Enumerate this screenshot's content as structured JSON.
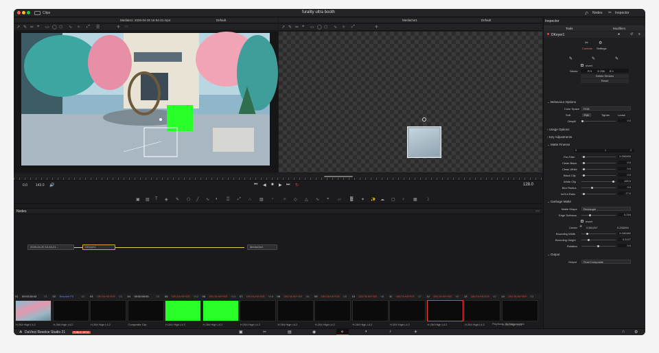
{
  "app": {
    "title": "furality ultra booth",
    "clips_label": "Clips",
    "product": "DaVinci Resolve Studio 21",
    "badge": "PUBLIC BETA"
  },
  "header": {
    "nodes_label": "Nodes",
    "inspector_label": "Inspector"
  },
  "viewer_left": {
    "title": "MediaIn1: 2026-04-20 16-54-21.mp4",
    "preset": "Default"
  },
  "viewer_right": {
    "title": "MediaOut1",
    "preset": "Default"
  },
  "transport": {
    "start": "0.0",
    "end": "143.0",
    "current": "128.0"
  },
  "nodes_panel": {
    "title": "Nodes",
    "nodes": [
      {
        "name": "2026-04-20 16-54-21..."
      },
      {
        "name": "DKeyer1"
      },
      {
        "name": "MediaOut1"
      }
    ]
  },
  "clips": [
    {
      "num": "01",
      "tc": "00:03:28:43",
      "v": "V1",
      "codec": "H.264 High L4.2"
    },
    {
      "num": "02",
      "tc": "Resolve FX",
      "v": "V2",
      "codec": "H.264 High L4.2"
    },
    {
      "num": "03",
      "tc": "DELTA KEYER",
      "v": "V3",
      "codec": "H.264 High L4.2"
    },
    {
      "num": "04",
      "tc": "00:00:00:00",
      "v": "V3",
      "codec": "Composite Clip"
    },
    {
      "num": "05",
      "tc": "DELTA KEYER",
      "v": "V12",
      "codec": "H.264 High L4.2"
    },
    {
      "num": "06",
      "tc": "DELTA KEYER",
      "v": "V14",
      "codec": "H.264 High L4.2"
    },
    {
      "num": "07",
      "tc": "DELTA KEYER",
      "v": "V15",
      "codec": "H.264 High L4.2"
    },
    {
      "num": "08",
      "tc": "DELTA KEYER",
      "v": "V6",
      "codec": "H.264 High L4.2"
    },
    {
      "num": "09",
      "tc": "DELTA KEYER",
      "v": "V8",
      "codec": "H.264 High L4.2"
    },
    {
      "num": "10",
      "tc": "DELTA KEYER",
      "v": "V8",
      "codec": "H.264 High L4.2"
    },
    {
      "num": "11",
      "tc": "DELTA KEYER",
      "v": "V7",
      "codec": "H.264 High L4.2"
    },
    {
      "num": "12",
      "tc": "DELTA KEYER",
      "v": "V2",
      "codec": "H.264 High L4.2"
    },
    {
      "num": "13",
      "tc": "DELTA KEYER",
      "v": "V2",
      "codec": "H.264 High L4.2"
    },
    {
      "num": "14",
      "tc": "DELTA KEYER",
      "v": "V3",
      "codec": "H.264 High L4.2"
    }
  ],
  "status": {
    "playback": "Playback: 30 Stereoscopic",
    "fps": "57.6 - 1.4 fps"
  },
  "inspector": {
    "title": "Inspector",
    "tabs": {
      "tools": "Tools",
      "modifiers": "Modifiers"
    },
    "tool_name": "DKeyer1",
    "subtabs": {
      "controls": "Controls",
      "settings": "Settings"
    },
    "invert_label": "Invert",
    "stroke_label": "Stroke",
    "stroke_values": {
      "r": "R 0",
      "g": "G 256",
      "b": "B 1"
    },
    "delete_strokes": "Delete Strokes",
    "reset": "Reset",
    "behaviour": {
      "title": "Behaviour Options",
      "color_space_label": "Color Space",
      "color_space_value": "RGB",
      "soft": "Soft",
      "flat": "Flat",
      "tighter": "Tighter",
      "loose": "Loose",
      "despill_label": "Despill",
      "despill_value": "0.0"
    },
    "usage": "Usage Options",
    "key_adjust": "Key Adjustments",
    "matte_finesse": {
      "title": "Matte Finesse",
      "range": [
        "0",
        "1",
        "2"
      ],
      "rows": [
        {
          "label": "Pre-Filter",
          "value": "0.200000"
        },
        {
          "label": "Clean Black",
          "value": "0.0"
        },
        {
          "label": "Clean White",
          "value": "0.0"
        },
        {
          "label": "Black Clip",
          "value": "0.0"
        },
        {
          "label": "White Clip",
          "value": "100.0"
        },
        {
          "label": "Blur Radius",
          "value": "3.0"
        },
        {
          "label": "In/Out Ratio",
          "value": "-77.0"
        }
      ]
    },
    "garbage_matte": {
      "title": "Garbage Matte",
      "matte_shape_label": "Matte Shape",
      "matte_shape_value": "Rectangle",
      "edge_softness_label": "Edge Softness",
      "edge_softness_value": "0.244",
      "invert_label": "Invert",
      "center_label": "Center",
      "center_x": "0.561257",
      "center_y": "0.233294",
      "bounding_width_label": "Bounding Width",
      "bounding_width_value": "0.182482",
      "bounding_height_label": "Bounding Height",
      "bounding_height_value": "0.2127",
      "rotation_label": "Rotation",
      "rotation_value": "0.0"
    },
    "output": {
      "title": "Output",
      "label": "Output",
      "value": "Final Composite"
    }
  },
  "colors": {
    "accent": "#ff3b3b",
    "green": "#29ff28",
    "bg": "#1b1b1d"
  }
}
